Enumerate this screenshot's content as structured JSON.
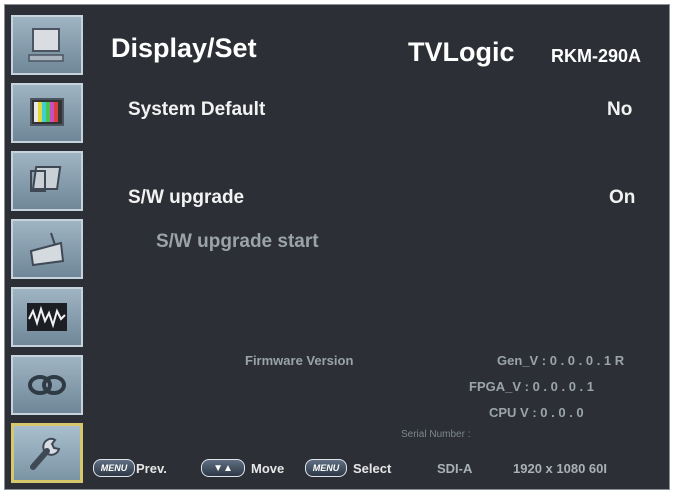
{
  "header": {
    "title": "Display/Set",
    "brand": "TVLogic",
    "model": "RKM-290A"
  },
  "settings": [
    {
      "label": "System Default",
      "value": "No"
    },
    {
      "label": "S/W upgrade",
      "value": "On"
    },
    {
      "label": "S/W upgrade start",
      "value": ""
    }
  ],
  "firmware": {
    "label": "Firmware Version",
    "gen": "Gen_V : 0 . 0 . 0 . 1 R",
    "fpga": "FPGA_V : 0 . 0 . 0 . 1",
    "cpu": "CPU V :     0 . 0 . 0",
    "serial": "Serial Number :"
  },
  "bottom_bar": {
    "menu_button": "MENU",
    "prev_label": "Prev.",
    "arrows_button": "▼▲",
    "move_label": "Move",
    "menu_button2": "MENU",
    "select_label": "Select",
    "input": "SDI-A",
    "resolution": "1920 x 1080  60I"
  },
  "sidebar": {
    "icons": [
      "monitor-icon",
      "color-bars-icon",
      "display-tilt-icon",
      "tv-antenna-icon",
      "waveform-icon",
      "link-icon",
      "wrench-icon"
    ],
    "active_index": 6
  },
  "colors": {
    "background": "#2c3036",
    "text": "#f2f2f2",
    "dim_text": "#9aa2aa",
    "active_border": "#d7c86b"
  }
}
